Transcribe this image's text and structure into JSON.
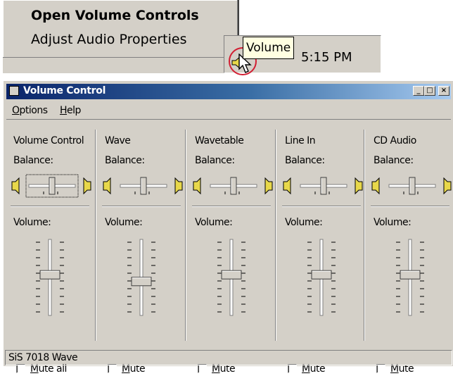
{
  "tray_menu": {
    "items": [
      {
        "label": "Open Volume Controls",
        "bold": true
      },
      {
        "label": "Adjust Audio Properties",
        "bold": false
      }
    ]
  },
  "taskbar": {
    "tooltip": "Volume",
    "clock": "5:15 PM",
    "icon": "speaker-icon"
  },
  "window": {
    "title": "Volume Control",
    "caption_buttons": [
      "minimize-icon",
      "maximize-icon",
      "close-icon"
    ],
    "menu": [
      {
        "label_ul": "O",
        "label_rest": "ptions"
      },
      {
        "label_ul": "H",
        "label_rest": "elp"
      }
    ],
    "balance_label": "Balance:",
    "volume_label": "Volume:",
    "channels": [
      {
        "name": "Volume Control",
        "mute_ul": "M",
        "mute_rest": "ute all",
        "volume": 0.55,
        "balance": 0.5,
        "focused": true
      },
      {
        "name": "Wave",
        "mute_ul": "M",
        "mute_rest": "ute",
        "volume": 0.45,
        "balance": 0.5,
        "focused": false
      },
      {
        "name": "Wavetable",
        "mute_ul": "M",
        "mute_rest": "ute",
        "volume": 0.55,
        "balance": 0.5,
        "focused": false
      },
      {
        "name": "Line In",
        "mute_ul": "M",
        "mute_rest": "ute",
        "volume": 0.55,
        "balance": 0.5,
        "focused": false
      },
      {
        "name": "CD Audio",
        "mute_ul": "M",
        "mute_rest": "ute",
        "volume": 0.55,
        "balance": 0.5,
        "focused": false
      }
    ],
    "status": "SiS 7018 Wave"
  },
  "colors": {
    "face": "#d4d0c8",
    "title_start": "#0a246a",
    "title_end": "#a6caf0",
    "highlight_ring": "#d21e32",
    "tooltip_bg": "#ffffe1"
  }
}
